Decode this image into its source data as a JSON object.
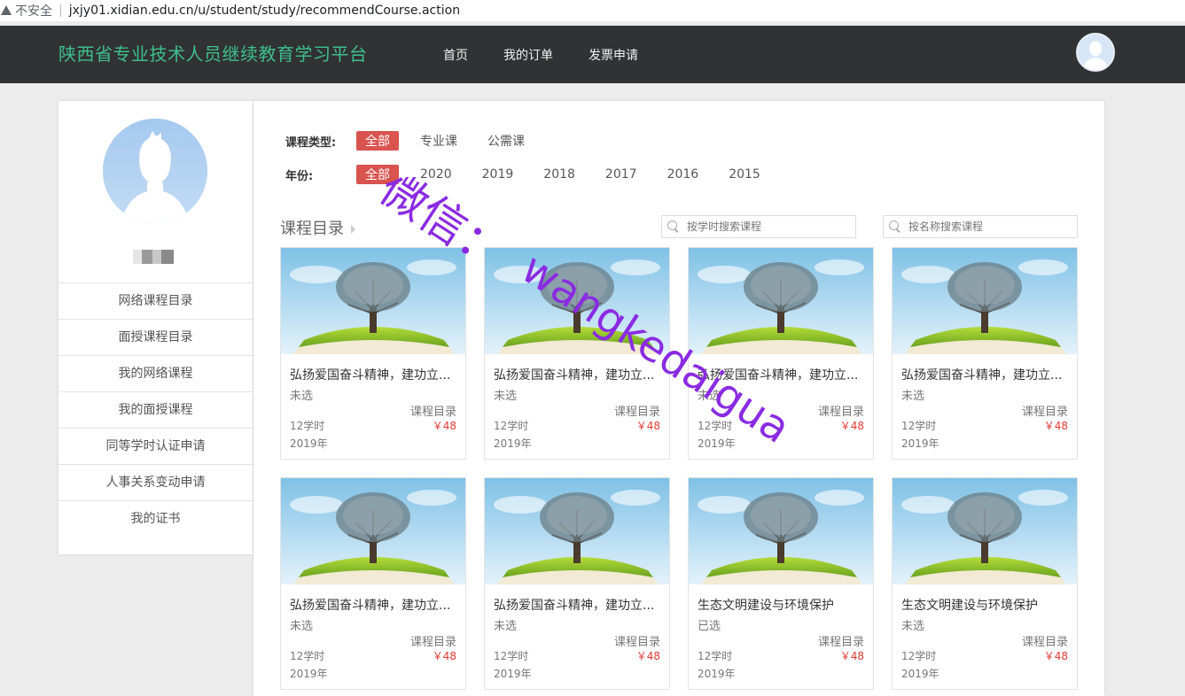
{
  "browser": {
    "insecure_label": "不安全",
    "url": "jxjy01.xidian.edu.cn/u/student/study/recommendCourse.action"
  },
  "header": {
    "brand": "陕西省专业技术人员继续教育学习平台",
    "nav": [
      "首页",
      "我的订单",
      "发票申请"
    ]
  },
  "sidebar": {
    "menu": [
      "网络课程目录",
      "面授课程目录",
      "我的网络课程",
      "我的面授课程",
      "同等学时认证申请",
      "人事关系变动申请",
      "我的证书"
    ]
  },
  "filters": {
    "type_label": "课程类型:",
    "types": [
      "全部",
      "专业课",
      "公需课"
    ],
    "type_active": "全部",
    "year_label": "年份:",
    "years": [
      "全部",
      "2020",
      "2019",
      "2018",
      "2017",
      "2016",
      "2015"
    ],
    "year_active": "全部"
  },
  "catalog": {
    "title": "课程目录",
    "search_hours_placeholder": "按学时搜索课程",
    "search_name_placeholder": "按名称搜索课程"
  },
  "courses": [
    {
      "title": "弘扬爱国奋斗精神，建功立...",
      "status": "未选",
      "catalog": "课程目录",
      "hours": "12学时",
      "price": "￥48",
      "year": "2019年"
    },
    {
      "title": "弘扬爱国奋斗精神，建功立...",
      "status": "未选",
      "catalog": "课程目录",
      "hours": "12学时",
      "price": "￥48",
      "year": "2019年"
    },
    {
      "title": "弘扬爱国奋斗精神，建功立...",
      "status": "未选",
      "catalog": "课程目录",
      "hours": "12学时",
      "price": "￥48",
      "year": "2019年"
    },
    {
      "title": "弘扬爱国奋斗精神，建功立...",
      "status": "未选",
      "catalog": "课程目录",
      "hours": "12学时",
      "price": "￥48",
      "year": "2019年"
    },
    {
      "title": "弘扬爱国奋斗精神，建功立...",
      "status": "未选",
      "catalog": "课程目录",
      "hours": "12学时",
      "price": "￥48",
      "year": "2019年"
    },
    {
      "title": "弘扬爱国奋斗精神，建功立...",
      "status": "未选",
      "catalog": "课程目录",
      "hours": "12学时",
      "price": "￥48",
      "year": "2019年"
    },
    {
      "title": "生态文明建设与环境保护",
      "status": "已选",
      "catalog": "课程目录",
      "hours": "12学时",
      "price": "￥48",
      "year": "2019年"
    },
    {
      "title": "生态文明建设与环境保护",
      "status": "未选",
      "catalog": "课程目录",
      "hours": "12学时",
      "price": "￥48",
      "year": "2019年"
    }
  ],
  "watermark": {
    "line1": "微信：",
    "line2": "wangkedaigua"
  },
  "colors": {
    "header_bg": "#313233",
    "brand": "#3dbf8d",
    "active_filter": "#d9534f",
    "price": "#e03c31",
    "watermark": "#8a2be2"
  }
}
